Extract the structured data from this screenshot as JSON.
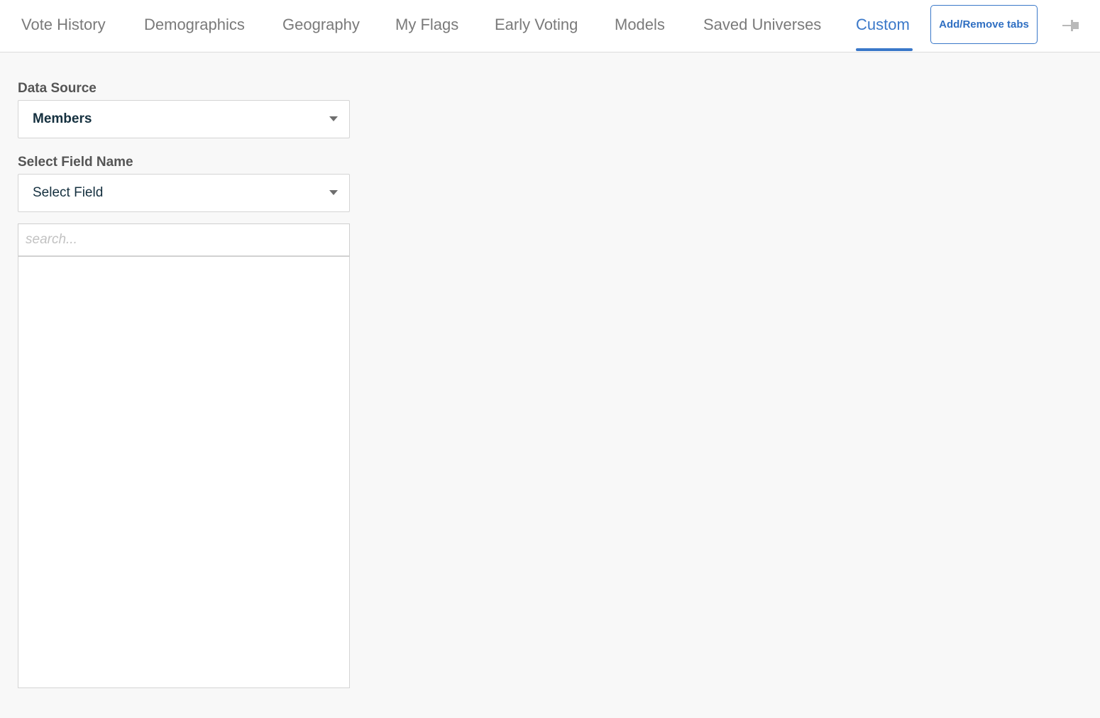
{
  "tabs": [
    {
      "label": "Vote History",
      "active": false
    },
    {
      "label": "Demographics",
      "active": false
    },
    {
      "label": "Geography",
      "active": false
    },
    {
      "label": "My Flags",
      "active": false
    },
    {
      "label": "Early Voting",
      "active": false
    },
    {
      "label": "Models",
      "active": false
    },
    {
      "label": "Saved Universes",
      "active": false
    },
    {
      "label": "Custom",
      "active": true
    }
  ],
  "add_remove_tabs_label": "Add/Remove tabs",
  "pin_icon": "pin-icon",
  "data_source": {
    "label": "Data Source",
    "value": "Members"
  },
  "field_name": {
    "label": "Select Field Name",
    "value": "Select Field"
  },
  "search": {
    "placeholder": "search...",
    "value": ""
  },
  "colors": {
    "accent": "#3a78c9",
    "tab_text": "#7a7a7a",
    "background": "#f8f8f8"
  }
}
